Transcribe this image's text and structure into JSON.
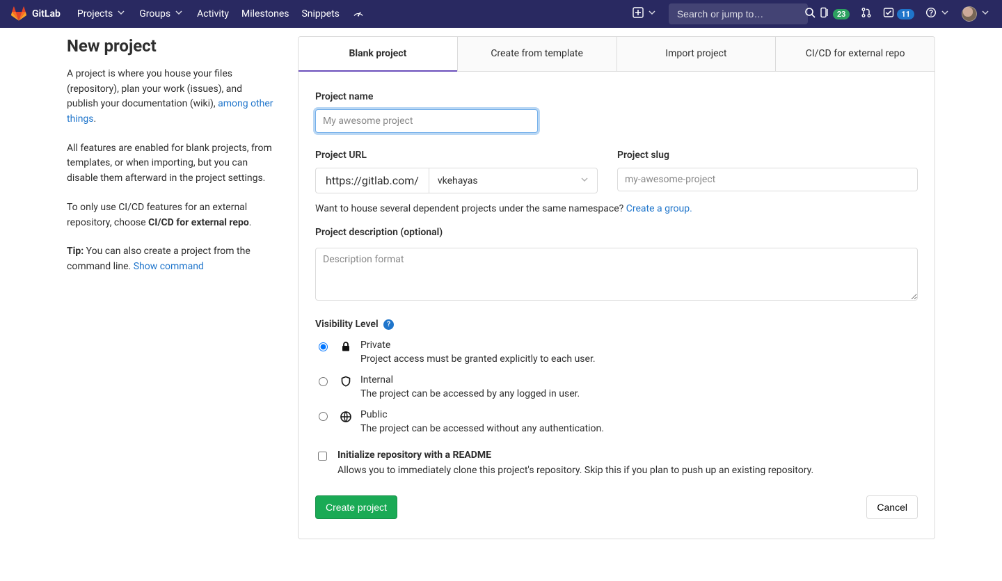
{
  "nav": {
    "brand": "GitLab",
    "links": {
      "projects": "Projects",
      "groups": "Groups",
      "activity": "Activity",
      "milestones": "Milestones",
      "snippets": "Snippets"
    },
    "search_placeholder": "Search or jump to…",
    "badges": {
      "cicd_count": "23",
      "todos_count": "11"
    }
  },
  "sidebar": {
    "title": "New project",
    "p1_before_link": "A project is where you house your files (repository), plan your work (issues), and publish your documentation (wiki), ",
    "p1_link": "among other things",
    "p1_after_link": ".",
    "p2": "All features are enabled for blank projects, from templates, or when importing, but you can disable them afterward in the project settings.",
    "p3_before_strong": "To only use CI/CD features for an external repository, choose ",
    "p3_strong": "CI/CD for external repo",
    "p3_after_strong": ".",
    "tip_label": "Tip:",
    "tip_text": " You can also create a project from the command line. ",
    "tip_link": "Show command"
  },
  "tabs": {
    "blank": "Blank project",
    "template": "Create from template",
    "import": "Import project",
    "cicd": "CI/CD for external repo"
  },
  "form": {
    "name_label": "Project name",
    "name_placeholder": "My awesome project",
    "url_label": "Project URL",
    "url_prefix": "https://gitlab.com/",
    "namespace_selected": "vkehayas",
    "slug_label": "Project slug",
    "slug_placeholder": "my-awesome-project",
    "group_hint_before": "Want to house several dependent projects under the same namespace? ",
    "group_hint_link": "Create a group.",
    "desc_label": "Project description (optional)",
    "desc_placeholder": "Description format",
    "visibility_label": "Visibility Level",
    "visibility": {
      "private": {
        "title": "Private",
        "desc": "Project access must be granted explicitly to each user."
      },
      "internal": {
        "title": "Internal",
        "desc": "The project can be accessed by any logged in user."
      },
      "public": {
        "title": "Public",
        "desc": "The project can be accessed without any authentication."
      }
    },
    "readme_title": "Initialize repository with a README",
    "readme_desc": "Allows you to immediately clone this project's repository. Skip this if you plan to push up an existing repository.",
    "create_button": "Create project",
    "cancel_button": "Cancel"
  }
}
